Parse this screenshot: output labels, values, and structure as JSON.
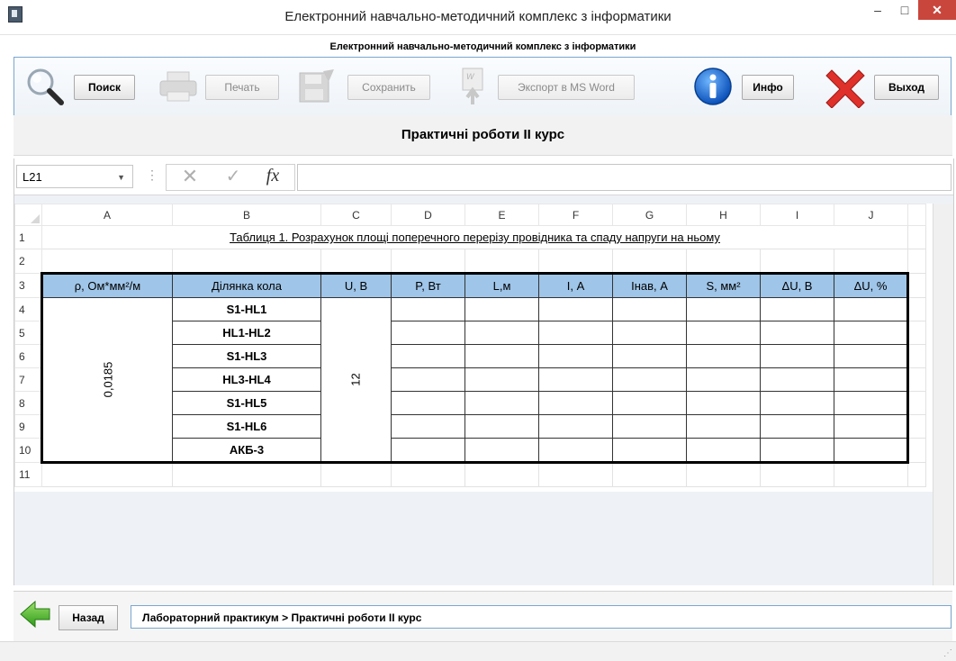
{
  "window": {
    "title": "Електронний навчально-методичний комплекс з інформатики",
    "min_glyph": "–",
    "max_glyph": "□",
    "close_glyph": "✕"
  },
  "header": {
    "subtitle": "Електронний навчально-методичний комплекс з інформатики"
  },
  "toolbar": {
    "search_label": "Поиск",
    "print_label": "Печать",
    "save_label": "Сохранить",
    "export_label": "Экспорт в MS Word",
    "info_label": "Инфо",
    "exit_label": "Выход"
  },
  "section": {
    "title": "Практичні роботи ІІ курс"
  },
  "excel": {
    "namebox": "L21",
    "fx_label": "fx",
    "columns": [
      "A",
      "B",
      "C",
      "D",
      "E",
      "F",
      "G",
      "H",
      "I",
      "J"
    ],
    "rows": [
      "1",
      "2",
      "3",
      "4",
      "5",
      "6",
      "7",
      "8",
      "9",
      "10",
      "11"
    ],
    "table_title": "Таблиця 1. Розрахунок площі поперечного перерізу провідника та спаду напруги на ньому",
    "headers": {
      "rho": "ρ, Ом*мм²/м",
      "segment": "Ділянка кола",
      "u": "U, В",
      "p": "P, Вт",
      "l": "L,м",
      "i": "I, А",
      "inav": "Інав, А",
      "s": "S, мм²",
      "du_v": "ΔU, В",
      "du_pct": "ΔU, %"
    },
    "rho_value": "0,0185",
    "u_value": "12",
    "segments": [
      "S1-HL1",
      "HL1-HL2",
      "S1-HL3",
      "HL3-HL4",
      "S1-HL5",
      "S1-HL6",
      "АКБ-3"
    ]
  },
  "footer": {
    "back_label": "Назад",
    "breadcrumb": "Лабораторний практикум > Практичні роботи ІІ курс"
  }
}
